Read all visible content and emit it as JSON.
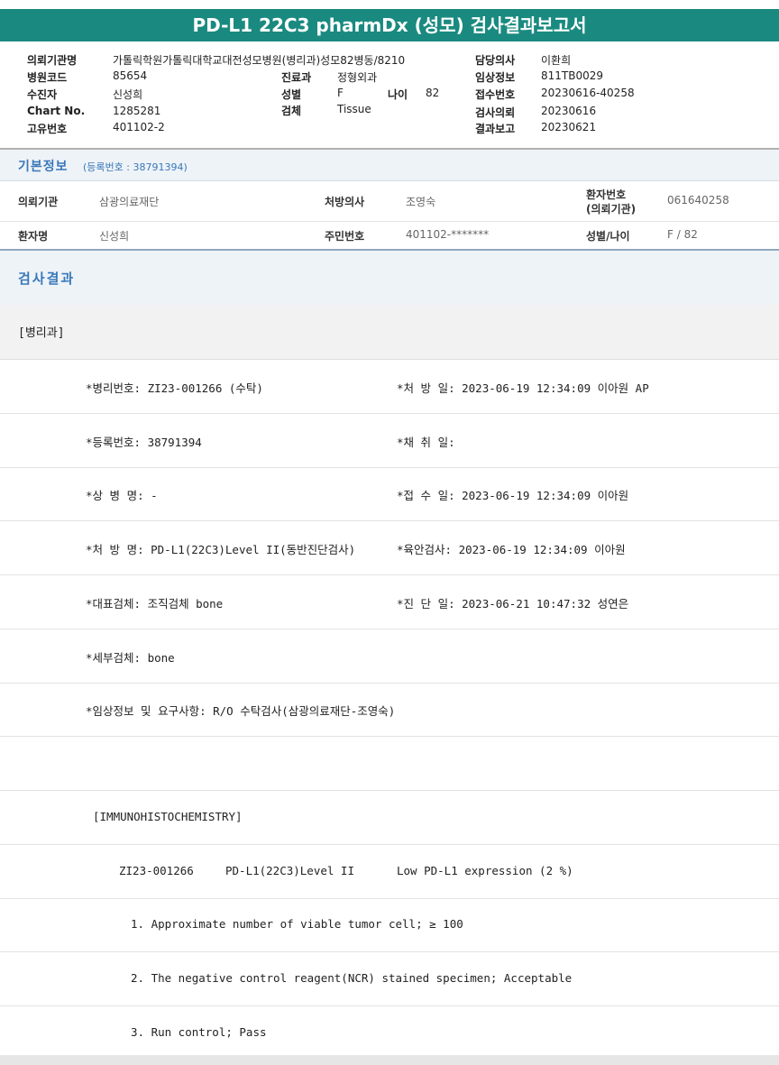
{
  "title": "PD-L1 22C3 pharmDx (성모) 검사결과보고서",
  "top_info": {
    "req_inst_label": "의뢰기관명",
    "req_inst": "가톨릭학원가톨릭대학교대전성모병원(병리과)성모82병동/8210",
    "hosp_code_label": "병원코드",
    "hosp_code": "85654",
    "recipient_label": "수진자",
    "recipient": "신성희",
    "chart_label": "Chart No.",
    "chart": "1285281",
    "uid_label": "고유번호",
    "uid": "401102-2",
    "dept_label": "진료과",
    "dept": "정형외과",
    "sex_label": "성별",
    "sex": "F",
    "age_label": "나이",
    "age": "82",
    "specimen_label": "검체",
    "specimen": "Tissue",
    "doctor_label": "담당의사",
    "doctor": "이환희",
    "clinical_label": "임상정보",
    "clinical": "811TB0029",
    "receipt_label": "접수번호",
    "receipt": "20230616-40258",
    "request_label": "검사의뢰",
    "request": "20230616",
    "report_label": "결과보고",
    "report": "20230621"
  },
  "basic": {
    "title": "기본정보",
    "reg": "(등록번호 : 38791394)",
    "inst_label": "의뢰기관",
    "inst": "삼광의료재단",
    "presc_label": "처방의사",
    "presc": "조영숙",
    "pid_label_1": "환자번호",
    "pid_label_2": "(의뢰기관)",
    "pid": "061640258",
    "pname_label": "환자명",
    "pname": "신성희",
    "rrn_label": "주민번호",
    "rrn": "401102-*******",
    "sexage_label": "성별/나이",
    "sexage": "F / 82"
  },
  "results": {
    "title": "검사결과",
    "dept": "[병리과]",
    "lines": {
      "path_no": "*병리번호: ZI23-001266 (수탁)",
      "presc_date": "*처 방 일: 2023-06-19 12:34:09  이아원 AP",
      "reg_no": "*등록번호: 38791394",
      "collect_date": "*채 취 일:",
      "diag_name": "*상 병 명: -",
      "receipt_date": "*접 수 일: 2023-06-19 12:34:09  이아원",
      "presc_name": "*처 방 명: PD-L1(22C3)Level II(동반진단검사)",
      "gross_date": "*육안검사: 2023-06-19 12:34:09  이아원",
      "rep_specimen": "*대표검체: 조직검체 bone",
      "diag_date": "*진 단 일: 2023-06-21 10:47:32  성연은",
      "sub_specimen": "*세부검체: bone",
      "clinical_req": "*임상정보 및 요구사항: R/O 수탁검사(삼광의료재단-조영숙)",
      "ihc": "[IMMUNOHISTOCHEMISTRY]",
      "ihc_id": "ZI23-001266",
      "ihc_test": "PD-L1(22C3)Level II",
      "ihc_result": "Low PD-L1 expression (2 %)",
      "item1": "1. Approximate number of viable tumor cell; ≥ 100",
      "item2": "2. The negative control reagent(NCR) stained specimen; Acceptable",
      "item3": "3. Run control; Pass"
    }
  }
}
